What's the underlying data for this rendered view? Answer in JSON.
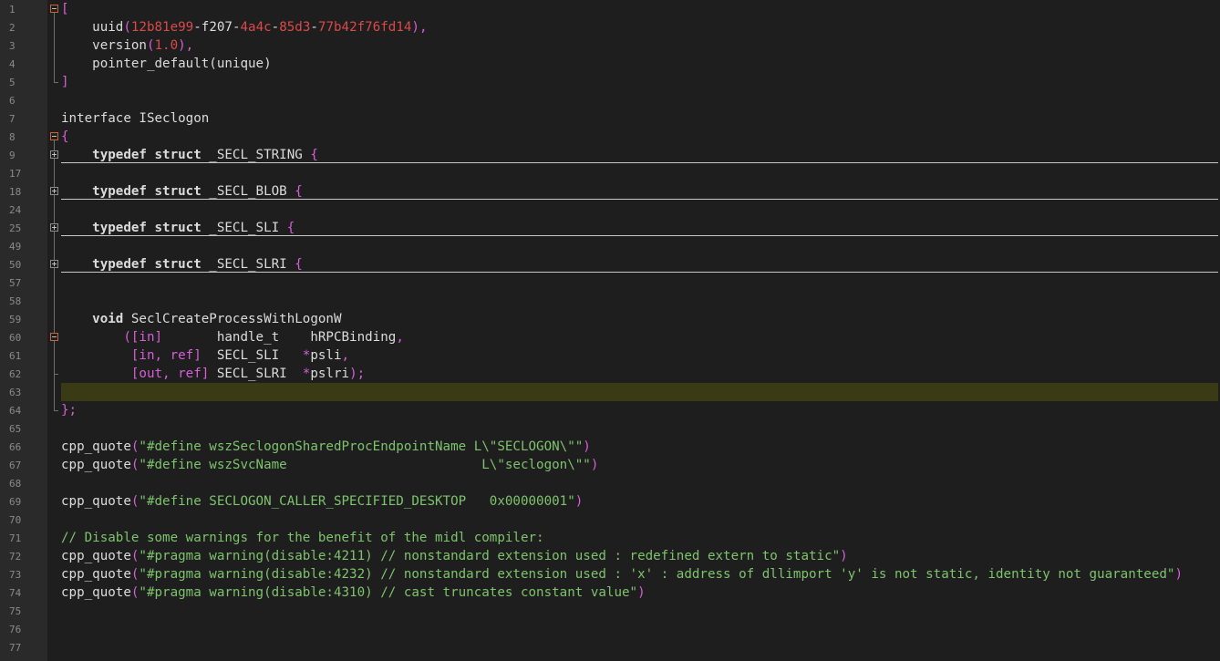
{
  "lines": [
    {
      "n": "1",
      "tokens": [
        {
          "t": "[",
          "c": "mag"
        }
      ]
    },
    {
      "n": "2",
      "tokens": [
        {
          "t": "    uuid",
          "c": "plain"
        },
        {
          "t": "(",
          "c": "mag"
        },
        {
          "t": "12b81e99",
          "c": "red"
        },
        {
          "t": "-f207-",
          "c": "plain"
        },
        {
          "t": "4a4c",
          "c": "red"
        },
        {
          "t": "-",
          "c": "plain"
        },
        {
          "t": "85d3",
          "c": "red"
        },
        {
          "t": "-",
          "c": "plain"
        },
        {
          "t": "77b42f76fd14",
          "c": "red"
        },
        {
          "t": "),",
          "c": "mag"
        }
      ]
    },
    {
      "n": "3",
      "tokens": [
        {
          "t": "    version",
          "c": "plain"
        },
        {
          "t": "(",
          "c": "mag"
        },
        {
          "t": "1.0",
          "c": "red"
        },
        {
          "t": "),",
          "c": "mag"
        }
      ]
    },
    {
      "n": "4",
      "tokens": [
        {
          "t": "    pointer_default(unique)",
          "c": "plain"
        }
      ]
    },
    {
      "n": "5",
      "tokens": [
        {
          "t": "]",
          "c": "mag"
        }
      ]
    },
    {
      "n": "6",
      "tokens": []
    },
    {
      "n": "7",
      "tokens": [
        {
          "t": "interface ISeclogon",
          "c": "plain"
        }
      ]
    },
    {
      "n": "8",
      "tokens": [
        {
          "t": "{",
          "c": "mag"
        }
      ]
    },
    {
      "n": "9",
      "tokens": [
        {
          "t": "    ",
          "c": "plain"
        },
        {
          "t": "typedef struct",
          "c": "kw"
        },
        {
          "t": " _SECL_STRING ",
          "c": "plain"
        },
        {
          "t": "{",
          "c": "mag"
        }
      ]
    },
    {
      "n": "17",
      "tokens": []
    },
    {
      "n": "18",
      "tokens": [
        {
          "t": "    ",
          "c": "plain"
        },
        {
          "t": "typedef struct",
          "c": "kw"
        },
        {
          "t": " _SECL_BLOB ",
          "c": "plain"
        },
        {
          "t": "{",
          "c": "mag"
        }
      ]
    },
    {
      "n": "24",
      "tokens": []
    },
    {
      "n": "25",
      "tokens": [
        {
          "t": "    ",
          "c": "plain"
        },
        {
          "t": "typedef struct",
          "c": "kw"
        },
        {
          "t": " _SECL_SLI ",
          "c": "plain"
        },
        {
          "t": "{",
          "c": "mag"
        }
      ]
    },
    {
      "n": "49",
      "tokens": []
    },
    {
      "n": "50",
      "tokens": [
        {
          "t": "    ",
          "c": "plain"
        },
        {
          "t": "typedef struct",
          "c": "kw"
        },
        {
          "t": " _SECL_SLRI ",
          "c": "plain"
        },
        {
          "t": "{",
          "c": "mag"
        }
      ]
    },
    {
      "n": "57",
      "tokens": []
    },
    {
      "n": "58",
      "tokens": []
    },
    {
      "n": "59",
      "tokens": [
        {
          "t": "    ",
          "c": "plain"
        },
        {
          "t": "void",
          "c": "kw"
        },
        {
          "t": " SeclCreateProcessWithLogonW",
          "c": "plain"
        }
      ]
    },
    {
      "n": "60",
      "tokens": [
        {
          "t": "        ",
          "c": "plain"
        },
        {
          "t": "([in]",
          "c": "mag"
        },
        {
          "t": "       handle_t    hRPCBinding",
          "c": "plain"
        },
        {
          "t": ",",
          "c": "mag"
        }
      ]
    },
    {
      "n": "61",
      "tokens": [
        {
          "t": "         ",
          "c": "plain"
        },
        {
          "t": "[in, ref]",
          "c": "mag"
        },
        {
          "t": "  SECL_SLI   ",
          "c": "plain"
        },
        {
          "t": "*",
          "c": "mag"
        },
        {
          "t": "psli",
          "c": "plain"
        },
        {
          "t": ",",
          "c": "mag"
        }
      ]
    },
    {
      "n": "62",
      "tokens": [
        {
          "t": "         ",
          "c": "plain"
        },
        {
          "t": "[out, ref]",
          "c": "mag"
        },
        {
          "t": " SECL_SLRI  ",
          "c": "plain"
        },
        {
          "t": "*",
          "c": "mag"
        },
        {
          "t": "pslri",
          "c": "plain"
        },
        {
          "t": ");",
          "c": "mag"
        }
      ]
    },
    {
      "n": "63",
      "tokens": []
    },
    {
      "n": "64",
      "tokens": [
        {
          "t": "};",
          "c": "mag"
        }
      ]
    },
    {
      "n": "65",
      "tokens": []
    },
    {
      "n": "66",
      "tokens": [
        {
          "t": "cpp_quote",
          "c": "plain"
        },
        {
          "t": "(",
          "c": "mag"
        },
        {
          "t": "\"#define wszSeclogonSharedProcEndpointName L\\\"SECLOGON\\\"\"",
          "c": "str"
        },
        {
          "t": ")",
          "c": "mag"
        }
      ]
    },
    {
      "n": "67",
      "tokens": [
        {
          "t": "cpp_quote",
          "c": "plain"
        },
        {
          "t": "(",
          "c": "mag"
        },
        {
          "t": "\"#define wszSvcName                         L\\\"seclogon\\\"\"",
          "c": "str"
        },
        {
          "t": ")",
          "c": "mag"
        }
      ]
    },
    {
      "n": "68",
      "tokens": []
    },
    {
      "n": "69",
      "tokens": [
        {
          "t": "cpp_quote",
          "c": "plain"
        },
        {
          "t": "(",
          "c": "mag"
        },
        {
          "t": "\"#define SECLOGON_CALLER_SPECIFIED_DESKTOP   0x00000001\"",
          "c": "str"
        },
        {
          "t": ")",
          "c": "mag"
        }
      ]
    },
    {
      "n": "70",
      "tokens": []
    },
    {
      "n": "71",
      "tokens": [
        {
          "t": "// Disable some warnings for the benefit of the midl compiler:",
          "c": "comment"
        }
      ]
    },
    {
      "n": "72",
      "tokens": [
        {
          "t": "cpp_quote",
          "c": "plain"
        },
        {
          "t": "(",
          "c": "mag"
        },
        {
          "t": "\"#pragma warning(disable:4211) // nonstandard extension used : redefined extern to static\"",
          "c": "str"
        },
        {
          "t": ")",
          "c": "mag"
        }
      ]
    },
    {
      "n": "73",
      "tokens": [
        {
          "t": "cpp_quote",
          "c": "plain"
        },
        {
          "t": "(",
          "c": "mag"
        },
        {
          "t": "\"#pragma warning(disable:4232) // nonstandard extension used : 'x' : address of dllimport 'y' is not static, identity not guaranteed\"",
          "c": "str"
        },
        {
          "t": ")",
          "c": "mag"
        }
      ]
    },
    {
      "n": "74",
      "tokens": [
        {
          "t": "cpp_quote",
          "c": "plain"
        },
        {
          "t": "(",
          "c": "mag"
        },
        {
          "t": "\"#pragma warning(disable:4310) // cast truncates constant value\"",
          "c": "str"
        },
        {
          "t": ")",
          "c": "mag"
        }
      ]
    },
    {
      "n": "75",
      "tokens": []
    },
    {
      "n": "76",
      "tokens": []
    },
    {
      "n": "77",
      "tokens": []
    }
  ],
  "current_line": "63",
  "collapsed_blocks": [
    "9",
    "18",
    "25",
    "50"
  ],
  "open_blocks": [
    "1",
    "8",
    "60"
  ],
  "colors": {
    "background": "#1e1e1e",
    "gutter": "#2a2a2a",
    "current_line": "#3a3a15",
    "string": "#7ec36d",
    "bracket": "#d75fd7",
    "number": "#d94a4a"
  }
}
